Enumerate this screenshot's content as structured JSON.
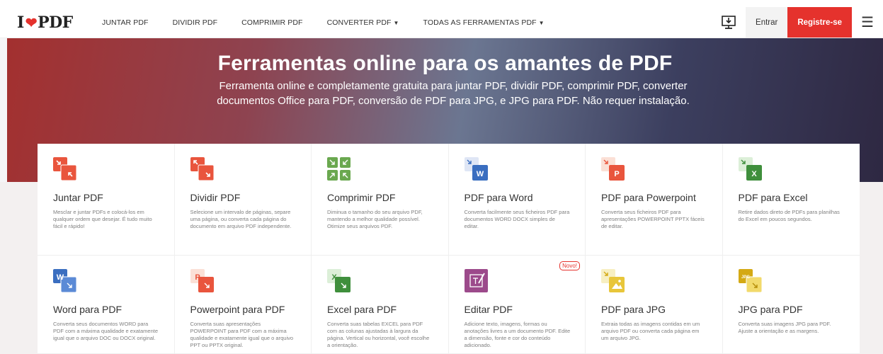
{
  "nav": {
    "logo_left": "I",
    "logo_right": "PDF",
    "links": [
      {
        "label": "JUNTAR PDF",
        "dropdown": false
      },
      {
        "label": "DIVIDIR PDF",
        "dropdown": false
      },
      {
        "label": "COMPRIMIR PDF",
        "dropdown": false
      },
      {
        "label": "CONVERTER PDF",
        "dropdown": true
      },
      {
        "label": "TODAS AS FERRAMENTAS PDF",
        "dropdown": true
      }
    ],
    "login_label": "Entrar",
    "register_label": "Registre-se",
    "desktop_icon": "desktop-download-icon",
    "menu_icon": "hamburger-menu-icon"
  },
  "hero": {
    "title": "Ferramentas online para os amantes de PDF",
    "subtitle": "Ferramenta online e completamente gratuita para juntar PDF, dividir PDF, comprimir PDF, converter documentos Office para PDF, conversão de PDF para JPG, e JPG para PDF. Não requer instalação."
  },
  "colors": {
    "brand_red": "#e5322d",
    "word_blue": "#3a6ec0",
    "ppt_orange": "#e9553d",
    "excel_green": "#3f8f3c",
    "edit_purple": "#9c4a8b",
    "jpg_yellow": "#e8c63a"
  },
  "tools": [
    {
      "title": "Juntar PDF",
      "desc": "Mesclar e juntar PDFs e colocá-los em qualquer ordem que desejar. É tudo muito fácil e rápido!",
      "icon": "merge-pdf-icon"
    },
    {
      "title": "Dividir PDF",
      "desc": "Selecione um intervalo de páginas, separe uma página, ou converta cada página do documento em arquivo PDF independente.",
      "icon": "split-pdf-icon"
    },
    {
      "title": "Comprimir PDF",
      "desc": "Diminua o tamanho do seu arquivo PDF, mantendo a melhor qualidade possível. Otimize seus arquivos PDF.",
      "icon": "compress-pdf-icon"
    },
    {
      "title": "PDF para Word",
      "desc": "Converta facilmente seus ficheiros PDF para documentos WORD DOCX simples de editar.",
      "icon": "pdf-to-word-icon"
    },
    {
      "title": "PDF para Powerpoint",
      "desc": "Converta seus ficheiros PDF para apresentações POWERPOINT PPTX fáceis de editar.",
      "icon": "pdf-to-powerpoint-icon"
    },
    {
      "title": "PDF para Excel",
      "desc": "Retire dados direto de PDFs para planilhas do Excel em poucos segundos.",
      "icon": "pdf-to-excel-icon"
    },
    {
      "title": "Word para PDF",
      "desc": "Converta seus documentos WORD para PDF com a máxima qualidade e exatamente igual que o arquivo DOC ou DOCX original.",
      "icon": "word-to-pdf-icon"
    },
    {
      "title": "Powerpoint para PDF",
      "desc": "Converta suas apresentações POWERPOINT para PDF com a máxima qualidade e exatamente igual que o arquivo PPT ou PPTX original.",
      "icon": "powerpoint-to-pdf-icon"
    },
    {
      "title": "Excel para PDF",
      "desc": "Converta suas tabelas EXCEL para PDF com as colunas ajustadas à largura da página. Vertical ou horizontal, você escolhe a orientação.",
      "icon": "excel-to-pdf-icon"
    },
    {
      "title": "Editar PDF",
      "desc": "Adicione texto, imagens, formas ou anotações livres a um documento PDF. Edite a dimensão, fonte e cor do conteúdo adicionado.",
      "icon": "edit-pdf-icon",
      "badge": "Novo!"
    },
    {
      "title": "PDF para JPG",
      "desc": "Extraia todas as imagens contidas em um arquivo PDF ou converta cada página em um arquivo JPG.",
      "icon": "pdf-to-jpg-icon"
    },
    {
      "title": "JPG para PDF",
      "desc": "Converta suas imagens JPG para PDF. Ajuste a orientação e as margens.",
      "icon": "jpg-to-pdf-icon"
    }
  ]
}
